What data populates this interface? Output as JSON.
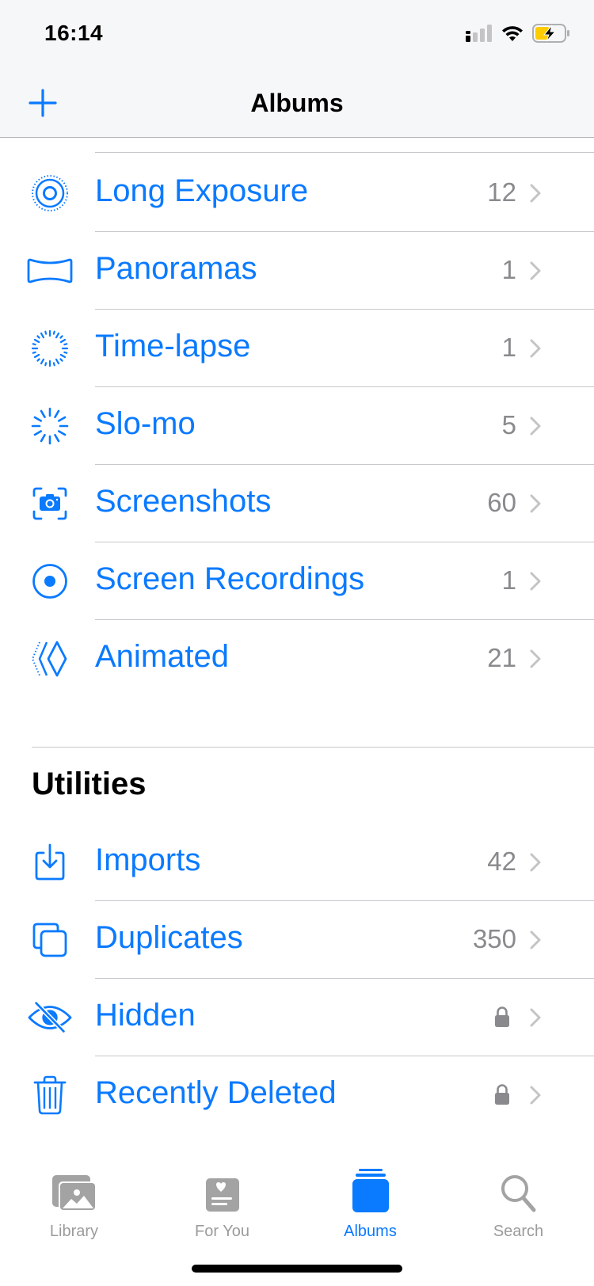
{
  "status_bar": {
    "time": "16:14",
    "icons": [
      "cellular-signal-icon",
      "wifi-icon",
      "battery-charging-icon"
    ],
    "battery_color": "#ffcc00"
  },
  "nav": {
    "title": "Albums",
    "add_icon": "plus-icon"
  },
  "accent_color": "#0a7aff",
  "media_types": [
    {
      "label": "Long Exposure",
      "count": "12",
      "icon": "long-exposure-icon"
    },
    {
      "label": "Panoramas",
      "count": "1",
      "icon": "panorama-icon"
    },
    {
      "label": "Time-lapse",
      "count": "1",
      "icon": "timelapse-icon"
    },
    {
      "label": "Slo-mo",
      "count": "5",
      "icon": "slomo-icon"
    },
    {
      "label": "Screenshots",
      "count": "60",
      "icon": "screenshot-icon"
    },
    {
      "label": "Screen Recordings",
      "count": "1",
      "icon": "screen-recording-icon"
    },
    {
      "label": "Animated",
      "count": "21",
      "icon": "animated-icon"
    }
  ],
  "utilities": {
    "title": "Utilities",
    "items": [
      {
        "label": "Imports",
        "count": "42",
        "icon": "import-icon"
      },
      {
        "label": "Duplicates",
        "count": "350",
        "icon": "duplicates-icon"
      },
      {
        "label": "Hidden",
        "locked": true,
        "icon": "eye-slash-icon"
      },
      {
        "label": "Recently Deleted",
        "locked": true,
        "icon": "trash-icon"
      }
    ]
  },
  "tab_bar": {
    "tabs": [
      {
        "label": "Library",
        "icon": "photo-library-icon",
        "active": false
      },
      {
        "label": "For You",
        "icon": "for-you-icon",
        "active": false
      },
      {
        "label": "Albums",
        "icon": "albums-icon",
        "active": true
      },
      {
        "label": "Search",
        "icon": "search-icon",
        "active": false
      }
    ]
  }
}
